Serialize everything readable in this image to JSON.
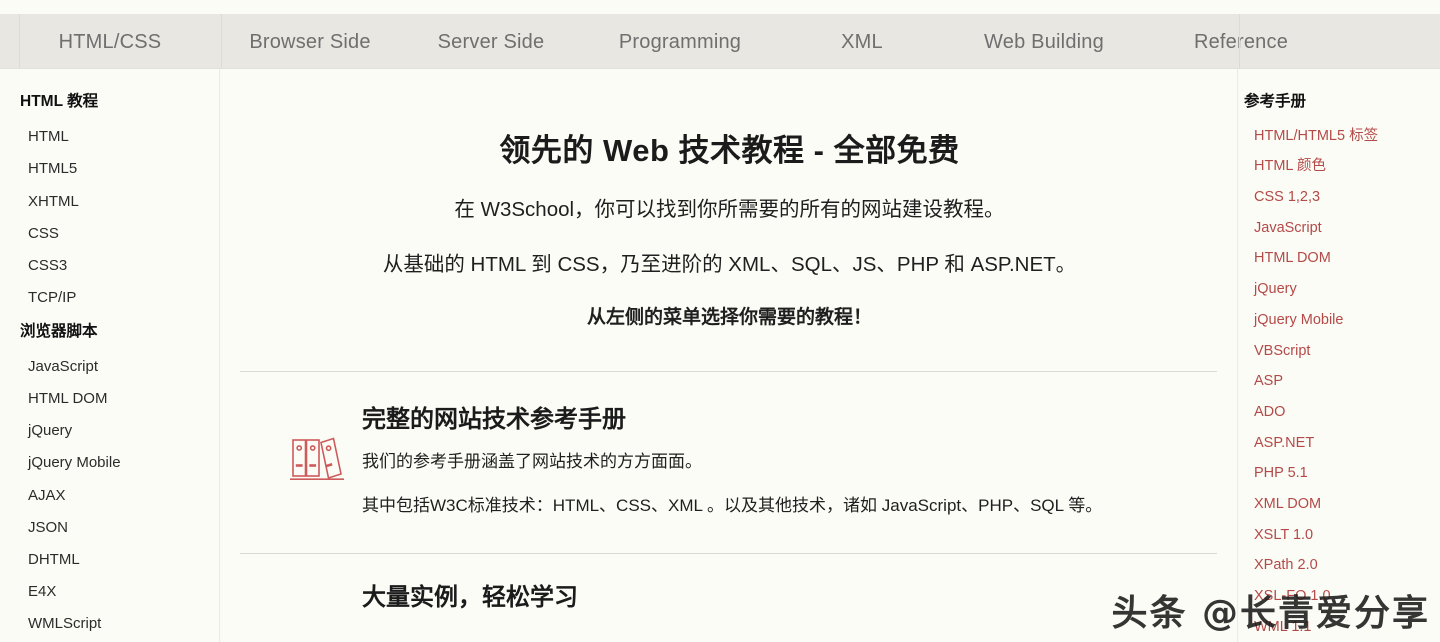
{
  "site": {
    "name": "W3School",
    "accent_red": "#b34a48",
    "nav_bg": "#e9e7e2",
    "page_bg": "#fcfcf7",
    "text_color": "#1f1f1f"
  },
  "topnav": {
    "items": [
      {
        "label": "HTML/CSS"
      },
      {
        "label": "Browser Side"
      },
      {
        "label": "Server Side"
      },
      {
        "label": "Programming"
      },
      {
        "label": "XML"
      },
      {
        "label": "Web Building"
      },
      {
        "label": "Reference"
      }
    ]
  },
  "left_sidebar": {
    "groups": [
      {
        "title": "HTML 教程",
        "items": [
          "HTML",
          "HTML5",
          "XHTML",
          "CSS",
          "CSS3",
          "TCP/IP"
        ]
      },
      {
        "title": "浏览器脚本",
        "items": [
          "JavaScript",
          "HTML DOM",
          "jQuery",
          "jQuery Mobile",
          "AJAX",
          "JSON",
          "DHTML",
          "E4X",
          "WMLScript"
        ]
      }
    ]
  },
  "main": {
    "hero": {
      "title": "领先的 Web 技术教程 - 全部免费",
      "line1": "在 W3School，你可以找到你所需要的所有的网站建设教程。",
      "line2": "从基础的 HTML 到 CSS，乃至进阶的 XML、SQL、JS、PHP 和 ASP.NET。",
      "line3": "从左侧的菜单选择你需要的教程！"
    },
    "sections": [
      {
        "icon": "books-icon",
        "title": "完整的网站技术参考手册",
        "paragraphs": [
          "我们的参考手册涵盖了网站技术的方方面面。",
          "其中包括W3C标准技术：HTML、CSS、XML 。以及其他技术，诸如 JavaScript、PHP、SQL 等。"
        ]
      }
    ],
    "partial_section": {
      "title": "大量实例，轻松学习"
    }
  },
  "right_sidebar": {
    "title": "参考手册",
    "items": [
      "HTML/HTML5 标签",
      "HTML 颜色",
      "CSS 1,2,3",
      "JavaScript",
      "HTML DOM",
      "jQuery",
      "jQuery Mobile",
      "VBScript",
      "ASP",
      "ADO",
      "ASP.NET",
      "PHP 5.1",
      "XML DOM",
      "XSLT 1.0",
      "XPath 2.0",
      "XSL-FO 1.0",
      "WML 1.1"
    ]
  },
  "watermark": {
    "text": "头条 @长青爱分享"
  }
}
